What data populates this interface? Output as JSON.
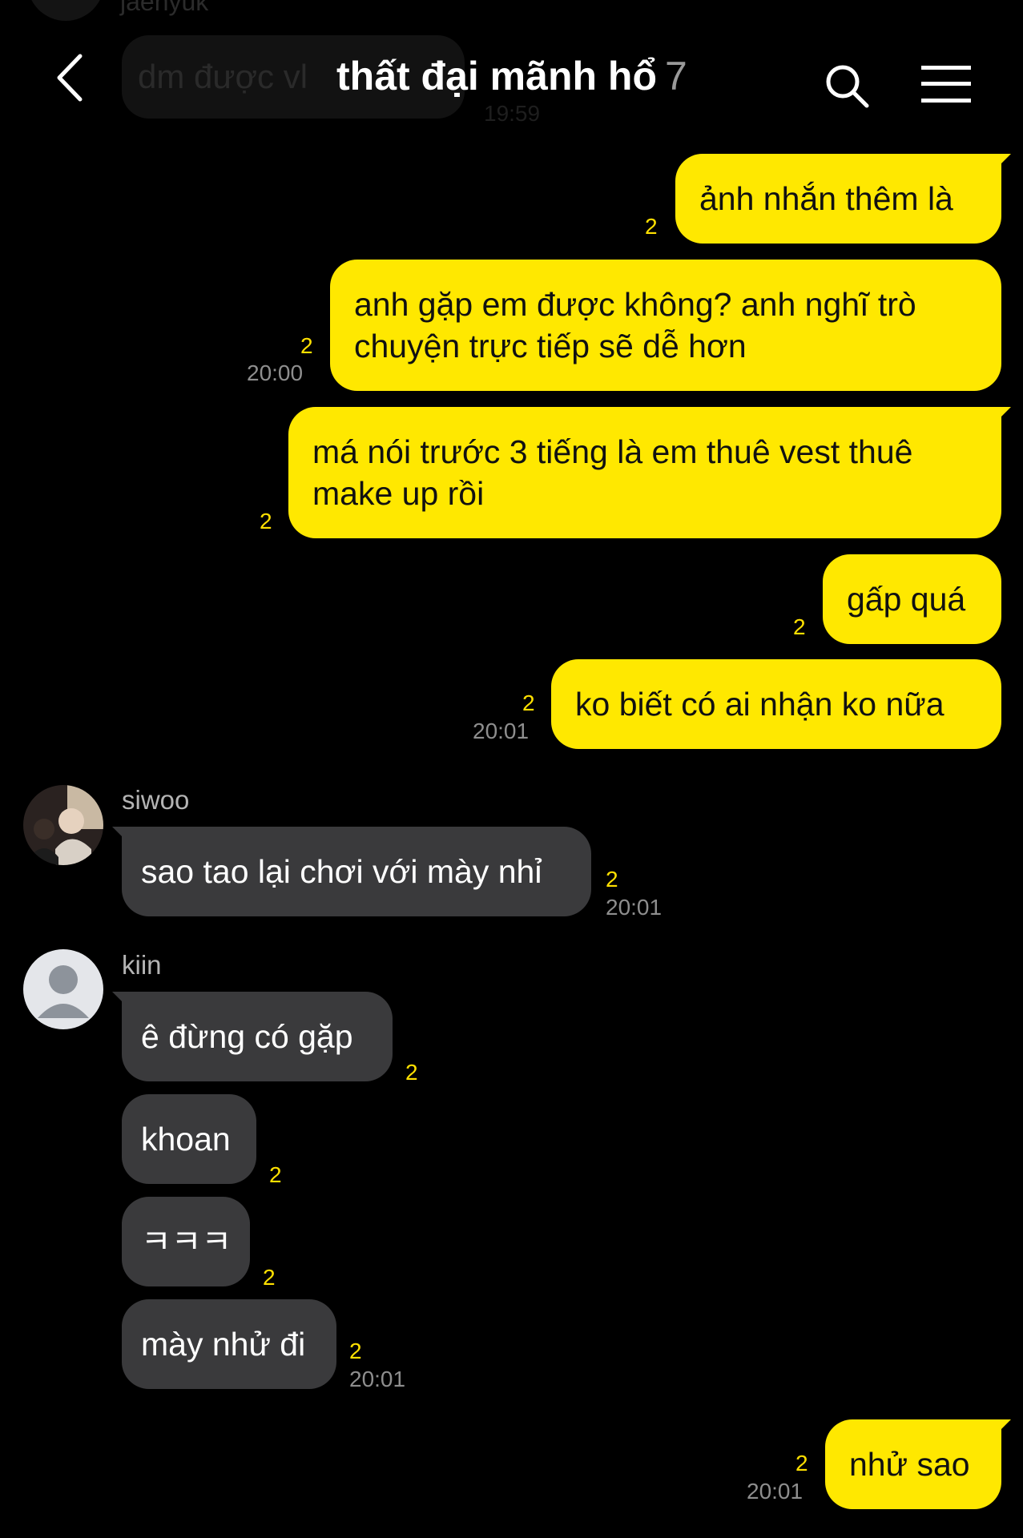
{
  "ghost": {
    "name": "jaehyuk",
    "text": "dm được vl",
    "time": "19:59"
  },
  "header": {
    "title": "thất đại mãnh hổ",
    "member_count": "7",
    "back_icon": "chevron-left-icon",
    "search_icon": "search-icon",
    "menu_icon": "hamburger-menu-icon"
  },
  "colors": {
    "my_bubble": "#ffe800",
    "their_bubble": "#3a3a3c",
    "unread": "#ffe000",
    "background": "#000000"
  },
  "messages": [
    {
      "text": "ảnh nhắn thêm là",
      "unread": "2"
    },
    {
      "lines": [
        "anh gặp em được không? anh nghĩ trò",
        "chuyện trực tiếp sẽ dễ hơn"
      ],
      "unread": "2",
      "time": "20:00"
    },
    {
      "lines": [
        "má nói trước 3 tiếng là em thuê vest thuê",
        "make up rồi"
      ],
      "unread": "2"
    },
    {
      "text": "gấp quá",
      "unread": "2"
    },
    {
      "text": "ko biết có ai nhận ko nữa",
      "unread": "2",
      "time": "20:01"
    },
    {
      "sender": "siwoo",
      "text": "sao tao lại chơi với mày nhỉ",
      "unread": "2",
      "time": "20:01"
    },
    {
      "sender": "kiin",
      "text": "ê đừng có gặp",
      "unread": "2"
    },
    {
      "text": "khoan",
      "unread": "2"
    },
    {
      "text": "ㅋㅋㅋ",
      "unread": "2"
    },
    {
      "text": "mày nhử đi",
      "unread": "2",
      "time": "20:01"
    },
    {
      "text": "nhử sao",
      "unread": "2",
      "time": "20:01"
    }
  ]
}
